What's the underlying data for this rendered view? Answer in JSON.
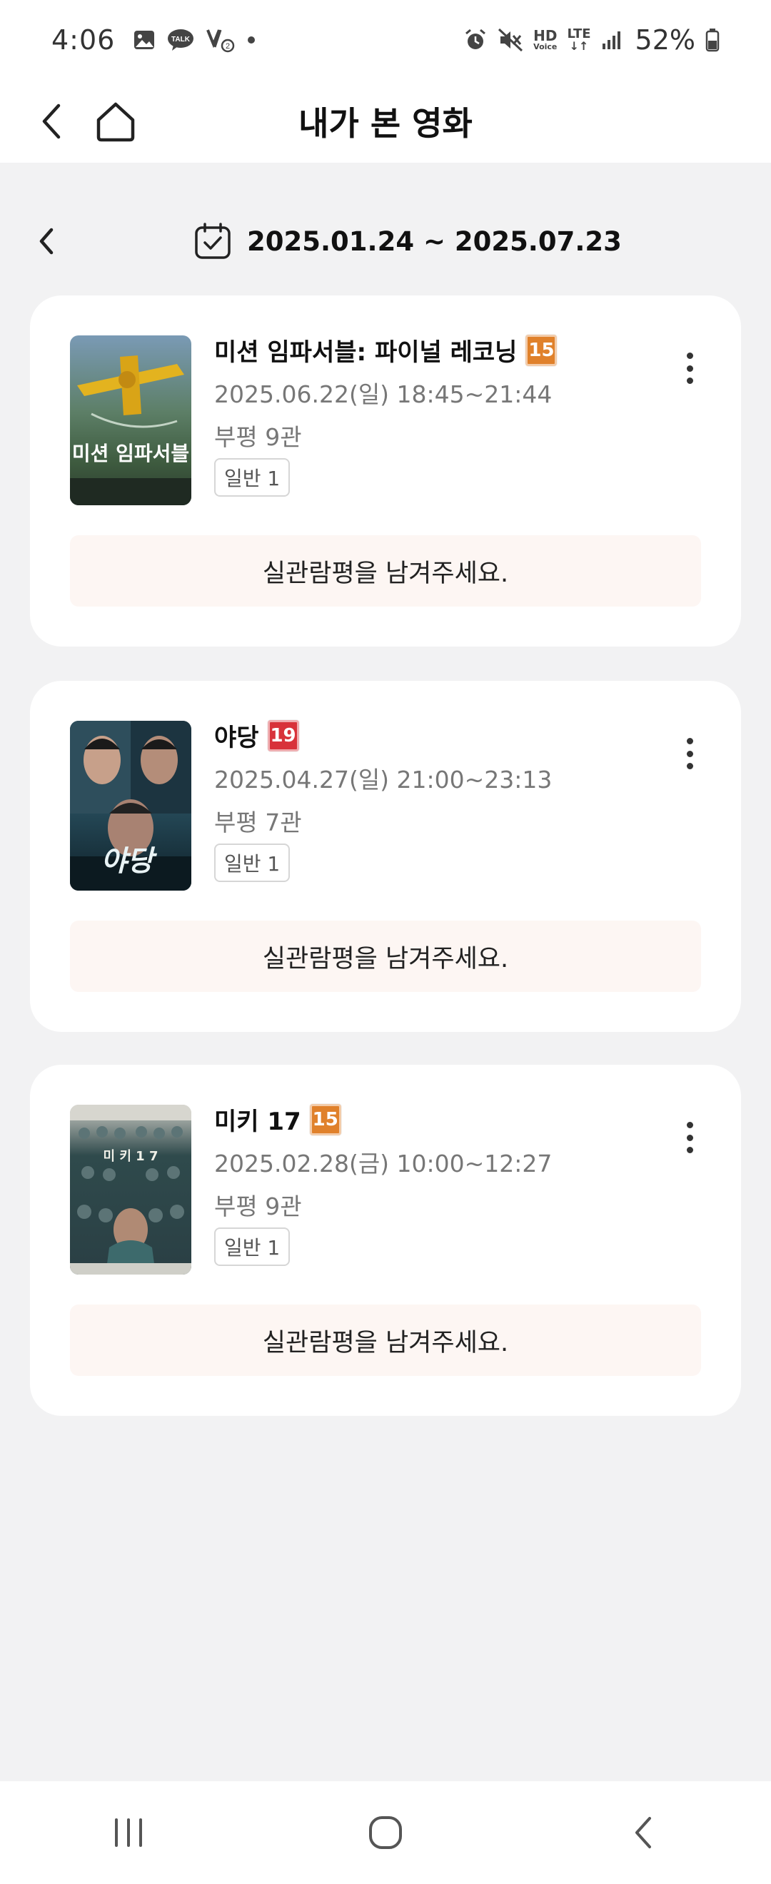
{
  "status_bar": {
    "time": "4:06",
    "talk_badge": "TALK",
    "hd_line1": "HD",
    "hd_line2": "Voice",
    "lte": "LTE",
    "battery": "52%"
  },
  "header": {
    "title": "내가 본 영화",
    "back_icon": "chevron-left-icon",
    "home_icon": "home-icon"
  },
  "range": {
    "text": "2025.01.24 ~ 2025.07.23",
    "calendar_icon": "calendar-check-icon"
  },
  "movies": [
    {
      "title": "미션 임파서블: 파이널 레코닝",
      "rating": "15",
      "rating_color": "#e0812b",
      "datetime": "2025.06.22(일) 18:45~21:44",
      "theater": "부평 9관",
      "ticket": "일반 1",
      "review_label": "실관람평을 남겨주세요.",
      "poster_text": "미션 임파서블"
    },
    {
      "title": "야당",
      "rating": "19",
      "rating_color": "#d8323a",
      "datetime": "2025.04.27(일) 21:00~23:13",
      "theater": "부평 7관",
      "ticket": "일반 1",
      "review_label": "실관람평을 남겨주세요.",
      "poster_text": "야당"
    },
    {
      "title": "미키 17",
      "rating": "15",
      "rating_color": "#e0812b",
      "datetime": "2025.02.28(금) 10:00~12:27",
      "theater": "부평 9관",
      "ticket": "일반 1",
      "review_label": "실관람평을 남겨주세요.",
      "poster_text": "미 키 1 7"
    }
  ],
  "colors": {
    "background": "#f2f2f3",
    "card": "#ffffff",
    "review_button": "#fdf6f3",
    "rating_15": "#e0812b",
    "rating_19": "#d8323a"
  }
}
